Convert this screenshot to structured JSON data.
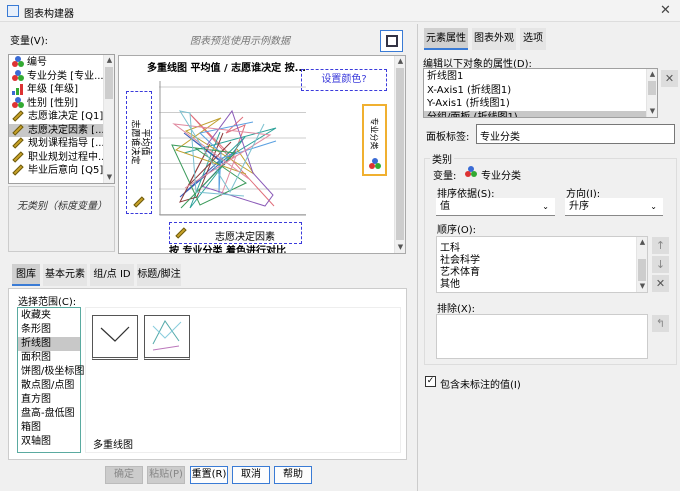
{
  "window": {
    "title": "图表构建器",
    "close_icon": "close-icon"
  },
  "left": {
    "variables_label": "变量(V):",
    "preview_note": "图表预览使用示例数据",
    "variables": [
      {
        "label": "编号",
        "icon": "nominal"
      },
      {
        "label": "专业分类 [专业...",
        "icon": "nominal"
      },
      {
        "label": "年级 [年级]",
        "icon": "ordinal"
      },
      {
        "label": "性别 [性别]",
        "icon": "nominal"
      },
      {
        "label": "志愿谁决定 [Q1]",
        "icon": "scale"
      },
      {
        "label": "志愿决定因素 [...",
        "icon": "scale",
        "selected": true
      },
      {
        "label": "规划课程指导 [...",
        "icon": "scale"
      },
      {
        "label": "职业规划过程中...",
        "icon": "scale"
      },
      {
        "label": "毕业后意向 [Q5]",
        "icon": "scale"
      }
    ],
    "category_note": "无类别（标度变量）",
    "canvas": {
      "title": "多重线图 平均值 / 志愿谁决定 按...",
      "set_color": "设置颜色?",
      "y_axis_label_1": "平均值",
      "y_axis_label_2": "志愿谁决定",
      "x_axis_label": "志愿决定因素",
      "panel_label": "专业分类",
      "footer_cut": "按 专业分类 着色进行对比",
      "line_colors": [
        "#3b5cb8",
        "#e06e7a",
        "#2aa198",
        "#8b3a3a",
        "#c0a030",
        "#5aa0e0",
        "#8a5ab8",
        "#3a9a5a",
        "#e08aa0",
        "#7ac0d0"
      ]
    },
    "tabs": [
      {
        "label": "图库",
        "active": true
      },
      {
        "label": "基本元素"
      },
      {
        "label": "组/点 ID"
      },
      {
        "label": "标题/脚注"
      }
    ],
    "gallery": {
      "choose_label": "选择范围(C):",
      "types": [
        "收藏夹",
        "条形图",
        "折线图",
        "面积图",
        "饼图/极坐标图",
        "散点图/点图",
        "直方图",
        "盘高-盘低图",
        "箱图",
        "双轴图"
      ],
      "selected_type": "折线图",
      "thumbnail_caption": "多重线图"
    }
  },
  "buttons": {
    "ok": "确定",
    "paste": "粘贴(P)",
    "reset": "重置(R)",
    "cancel": "取消",
    "help": "帮助"
  },
  "right": {
    "tabs": [
      {
        "label": "元素属性",
        "active": true
      },
      {
        "label": "图表外观"
      },
      {
        "label": "选项"
      }
    ],
    "edit_label": "编辑以下对象的属性(D):",
    "objects": [
      "折线图1",
      "X-Axis1 (折线图1)",
      "Y-Axis1 (折线图1)",
      "分组/面板 (折线图1)"
    ],
    "panel_label_caption": "面板标签:",
    "panel_label_value": "专业分类",
    "group_title": "类别",
    "variable_caption": "变量:",
    "variable_value": "专业分类",
    "sort_by_label": "排序依据(S):",
    "sort_by_value": "值",
    "direction_label": "方向(I):",
    "direction_value": "升序",
    "order_label": "顺序(O):",
    "order_items": [
      "工科",
      "社会科学",
      "艺术体育",
      "其他"
    ],
    "exclude_label": "排除(X):",
    "include_unlabeled": "包含未标注的值(I)",
    "include_unlabeled_checked": true
  }
}
